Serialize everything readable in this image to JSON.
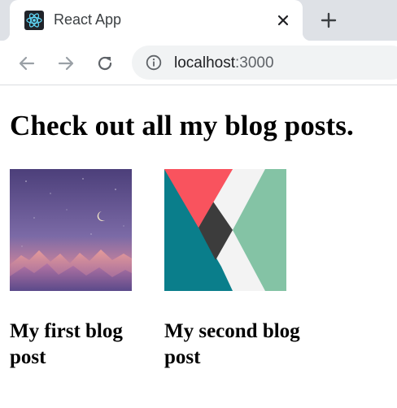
{
  "browser": {
    "tab": {
      "title": "React App",
      "favicon": "react-logo-icon"
    },
    "address_bar": {
      "host": "localhost",
      "port": ":3000"
    }
  },
  "page": {
    "heading": "Check out all my blog posts.",
    "posts": [
      {
        "title": "My first blog post",
        "thumbnail": "night-mountains-illustration"
      },
      {
        "title": "My second blog post",
        "thumbnail": "kotlin-style-logo"
      }
    ]
  },
  "colors": {
    "tabstrip": "#dee1e6",
    "omnibox": "#f1f3f4",
    "react_cyan": "#61dafb",
    "thumb1_sky": "#6a5a8c",
    "thumb2_red": "#f9535e",
    "thumb2_teal": "#0a7e8b",
    "thumb2_green": "#84c3a5",
    "thumb2_dark": "#3c3c3c"
  }
}
